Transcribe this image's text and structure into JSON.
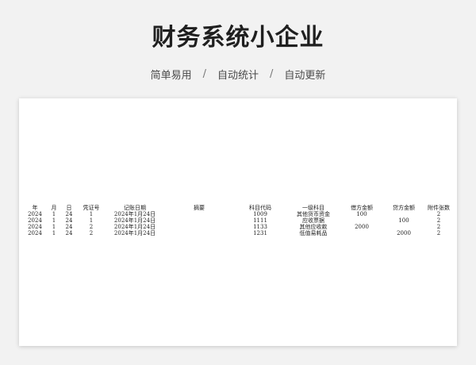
{
  "header": {
    "title": "财务系统小企业",
    "features": [
      "简单易用",
      "自动统计",
      "自动更新"
    ],
    "separator": "/"
  },
  "ledger": {
    "columns": [
      "年",
      "月",
      "日",
      "凭证号",
      "记账日期",
      "摘要",
      "科目代码",
      "一级科目",
      "借方金额",
      "贷方金额",
      "附件张数"
    ],
    "rows": [
      [
        "2024",
        "1",
        "24",
        "1",
        "2024年1月24日",
        "",
        "1009",
        "其他货币资金",
        "100",
        "",
        "2"
      ],
      [
        "2024",
        "1",
        "24",
        "1",
        "2024年1月24日",
        "",
        "1111",
        "应收票据",
        "",
        "100",
        "2"
      ],
      [
        "2024",
        "1",
        "24",
        "2",
        "2024年1月24日",
        "",
        "1133",
        "其他应收款",
        "2000",
        "",
        "2"
      ],
      [
        "2024",
        "1",
        "24",
        "2",
        "2024年1月24日",
        "",
        "1231",
        "低值易耗品",
        "",
        "2000",
        "2"
      ]
    ]
  }
}
